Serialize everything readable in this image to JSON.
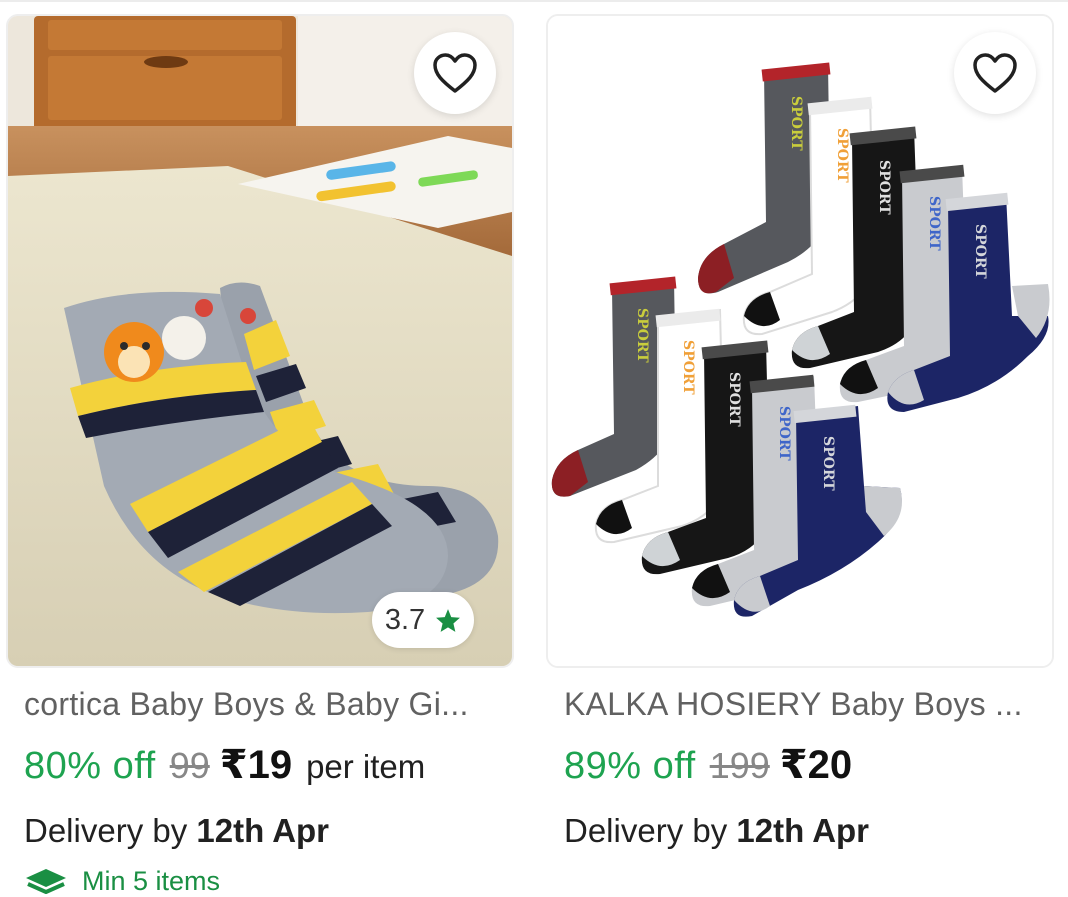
{
  "products": [
    {
      "title": "cortica Baby Boys & Baby Gi...",
      "discount": "80% off",
      "mrp": "99",
      "price": "₹19",
      "per_item": "per item",
      "delivery_prefix": "Delivery by",
      "delivery_date": "12th Apr",
      "rating": "3.7",
      "min_items": "Min 5 items",
      "image_icon": "socks-photo"
    },
    {
      "title": "KALKA HOSIERY Baby Boys ...",
      "discount": "89% off",
      "mrp": "199",
      "price": "₹20",
      "delivery_prefix": "Delivery by",
      "delivery_date": "12th Apr",
      "image_icon": "sport-socks-photo",
      "sock_label": "SPORT"
    }
  ],
  "colors": {
    "discount_green": "#1ea350",
    "rating_star": "#1a8f43",
    "mrp_grey": "#878787"
  }
}
